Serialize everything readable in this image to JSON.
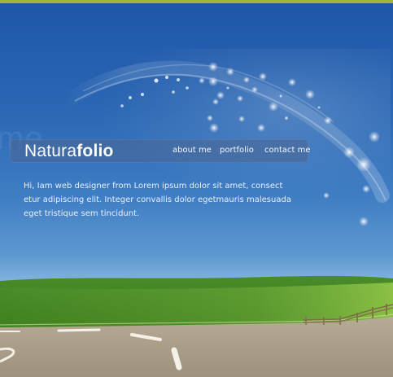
{
  "brand": {
    "name_light": "Natura",
    "name_bold": "folio"
  },
  "nav": {
    "items": [
      {
        "label": "about me"
      },
      {
        "label": "portfolio"
      },
      {
        "label": "contact me"
      }
    ]
  },
  "intro": {
    "text": "Hi, Iam web designer from Lorem ipsum dolor sit amet, consect etur adipiscing elit. Integer convallis dolor egetmauris malesuada eget tristique sem tincidunt."
  },
  "background": {
    "ghost_text": "me"
  },
  "colors": {
    "accent_strip": "#a6b53a",
    "sky_top": "#1e56a8",
    "sky_mid": "#3f7dc4",
    "grass": "#4f9a2a",
    "road": "#b7ab97"
  },
  "icons": {
    "hero": "sky-swirl-icon",
    "scene": "road-landscape-icon"
  }
}
